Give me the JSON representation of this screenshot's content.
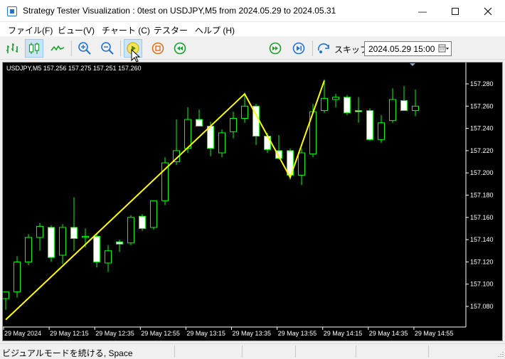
{
  "window": {
    "title": "Strategy Tester Visualization : 0test on USDJPY,M5 from 2024.05.29 to 2024.05.31",
    "minimize": "—"
  },
  "menu": [
    {
      "label": "ファイル(F)"
    },
    {
      "label": "ビュー(V)"
    },
    {
      "label": "チャート (C)"
    },
    {
      "label": "テスター"
    },
    {
      "label": "ヘルプ (H)"
    }
  ],
  "toolbar": {
    "skip_label": "スキップ",
    "date_value": "2024.05.29 15:00",
    "icons": [
      "bar-chart-icon",
      "candlestick-chart-icon",
      "line-chart-icon",
      "zoom-in-icon",
      "zoom-out-icon",
      "play-icon",
      "stop-icon",
      "rewind-icon",
      "fast-forward-icon",
      "step-forward-icon",
      "skip-icon",
      "calendar-icon"
    ]
  },
  "colors": {
    "bull_candle": "#000000",
    "bear_candle": "#ffffff",
    "wick": "#00ff00",
    "zigzag": "#ffff00",
    "chart_bg": "#000000",
    "chart_text": "#ffffff",
    "accent_blue": "#1e73d6"
  },
  "chart_data": {
    "type": "candlestick",
    "symbol_info": "USDJPY,M5  157.256 157.275 157.251 157.260",
    "yticks": [
      "157.280",
      "157.260",
      "157.240",
      "157.220",
      "157.200",
      "157.180",
      "157.160",
      "157.140",
      "157.120",
      "157.100",
      "157.080"
    ],
    "ylim": [
      157.063,
      157.306
    ],
    "xticks": [
      "29 May 2024",
      "29 May 12:15",
      "29 May 12:35",
      "29 May 12:55",
      "29 May 13:15",
      "29 May 13:35",
      "29 May 13:55",
      "29 May 14:15",
      "29 May 14:35",
      "29 May 14:55"
    ],
    "candles": [
      {
        "o": 157.087,
        "h": 157.093,
        "l": 157.077,
        "c": 157.093
      },
      {
        "o": 157.093,
        "h": 157.125,
        "l": 157.088,
        "c": 157.12
      },
      {
        "o": 157.12,
        "h": 157.145,
        "l": 157.117,
        "c": 157.142
      },
      {
        "o": 157.142,
        "h": 157.155,
        "l": 157.13,
        "c": 157.152
      },
      {
        "o": 157.151,
        "h": 157.153,
        "l": 157.12,
        "c": 157.124
      },
      {
        "o": 157.126,
        "h": 157.154,
        "l": 157.118,
        "c": 157.151
      },
      {
        "o": 157.151,
        "h": 157.178,
        "l": 157.13,
        "c": 157.141
      },
      {
        "o": 157.142,
        "h": 157.15,
        "l": 157.133,
        "c": 157.143
      },
      {
        "o": 157.143,
        "h": 157.146,
        "l": 157.115,
        "c": 157.12
      },
      {
        "o": 157.119,
        "h": 157.135,
        "l": 157.111,
        "c": 157.13
      },
      {
        "o": 157.138,
        "h": 157.14,
        "l": 157.129,
        "c": 157.136
      },
      {
        "o": 157.137,
        "h": 157.162,
        "l": 157.135,
        "c": 157.16
      },
      {
        "o": 157.161,
        "h": 157.163,
        "l": 157.148,
        "c": 157.15
      },
      {
        "o": 157.151,
        "h": 157.175,
        "l": 157.149,
        "c": 157.175
      },
      {
        "o": 157.175,
        "h": 157.214,
        "l": 157.171,
        "c": 157.209
      },
      {
        "o": 157.21,
        "h": 157.248,
        "l": 157.207,
        "c": 157.22
      },
      {
        "o": 157.222,
        "h": 157.259,
        "l": 157.218,
        "c": 157.248
      },
      {
        "o": 157.248,
        "h": 157.257,
        "l": 157.242,
        "c": 157.242
      },
      {
        "o": 157.242,
        "h": 157.246,
        "l": 157.215,
        "c": 157.222
      },
      {
        "o": 157.218,
        "h": 157.239,
        "l": 157.214,
        "c": 157.236
      },
      {
        "o": 157.237,
        "h": 157.255,
        "l": 157.231,
        "c": 157.249
      },
      {
        "o": 157.249,
        "h": 157.272,
        "l": 157.245,
        "c": 157.26
      },
      {
        "o": 157.26,
        "h": 157.262,
        "l": 157.225,
        "c": 157.233
      },
      {
        "o": 157.233,
        "h": 157.236,
        "l": 157.218,
        "c": 157.221
      },
      {
        "o": 157.22,
        "h": 157.234,
        "l": 157.212,
        "c": 157.213
      },
      {
        "o": 157.22,
        "h": 157.222,
        "l": 157.194,
        "c": 157.198
      },
      {
        "o": 157.198,
        "h": 157.222,
        "l": 157.189,
        "c": 157.218
      },
      {
        "o": 157.217,
        "h": 157.262,
        "l": 157.214,
        "c": 157.255
      },
      {
        "o": 157.256,
        "h": 157.284,
        "l": 157.254,
        "c": 157.267
      },
      {
        "o": 157.266,
        "h": 157.271,
        "l": 157.259,
        "c": 157.268
      },
      {
        "o": 157.268,
        "h": 157.27,
        "l": 157.252,
        "c": 157.254
      },
      {
        "o": 157.256,
        "h": 157.268,
        "l": 157.245,
        "c": 157.255
      },
      {
        "o": 157.256,
        "h": 157.258,
        "l": 157.229,
        "c": 157.23
      },
      {
        "o": 157.23,
        "h": 157.252,
        "l": 157.227,
        "c": 157.245
      },
      {
        "o": 157.247,
        "h": 157.276,
        "l": 157.245,
        "c": 157.266
      },
      {
        "o": 157.265,
        "h": 157.278,
        "l": 157.256,
        "c": 157.256
      },
      {
        "o": 157.256,
        "h": 157.275,
        "l": 157.251,
        "c": 157.26
      }
    ],
    "zigzag": [
      {
        "i": 0,
        "v": 157.068
      },
      {
        "i": 21,
        "v": 157.271
      },
      {
        "i": 25,
        "v": 157.196
      },
      {
        "i": 28,
        "v": 157.283
      }
    ]
  },
  "status": {
    "text": "ビジュアルモードを続ける, Space"
  }
}
